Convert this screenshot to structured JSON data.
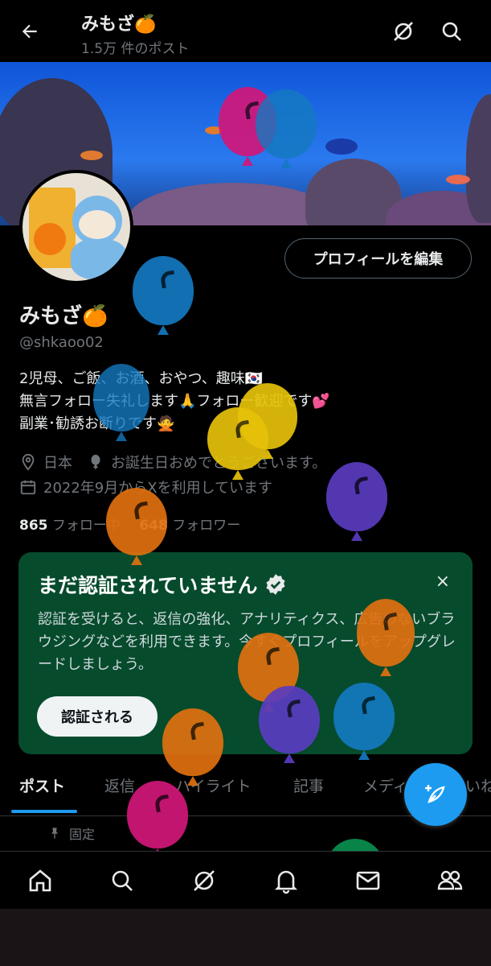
{
  "header": {
    "name": "みもざ🍊",
    "post_count": "1.5万 件のポスト"
  },
  "profile": {
    "edit_button": "プロフィールを編集",
    "name": "みもざ🍊",
    "handle": "@shkaoo02",
    "bio_lines": [
      "2児母、ご飯、お酒、おやつ、趣味🇰🇷",
      "無言フォロー失礼します🙏フォロー歓迎です💕",
      "副業･勧誘お断りです🙅"
    ],
    "location": "日本",
    "birthday": "お誕生日おめでとうございます。",
    "joined": "2022年9月からXを利用しています",
    "following_count": "865",
    "following_label": "フォロー中",
    "followers_count": "648",
    "followers_label": "フォロワー"
  },
  "verify_card": {
    "title": "まだ認証されていません",
    "close": "×",
    "body": "認証を受けると、返信の強化、アナリティクス、広告のないブラウジングなどを利用できます。今すぐプロフィールをアップグレードしましょう。",
    "button": "認証される"
  },
  "tabs": [
    "ポスト",
    "返信",
    "ハイライト",
    "記事",
    "メディア",
    "いいね"
  ],
  "pinned_label": "固定",
  "colors": {
    "accent": "#1d9bf0",
    "card_bg": "#064b2c",
    "balloon_magenta": "#d2177a",
    "balloon_blue": "#1479c0",
    "balloon_yellow": "#e6c20a",
    "balloon_purple": "#5a3cc0",
    "balloon_orange": "#e07010",
    "balloon_green": "#0a9050"
  },
  "icons": {
    "back": "back-arrow-icon",
    "grok": "grok-icon",
    "search": "search-icon",
    "location": "location-icon",
    "balloon": "balloon-icon",
    "calendar": "calendar-icon",
    "verified": "verified-badge-icon",
    "pin": "pin-icon",
    "compose": "compose-icon",
    "home": "home-icon",
    "notifications": "bell-icon",
    "messages": "mail-icon",
    "communities": "communities-icon"
  }
}
